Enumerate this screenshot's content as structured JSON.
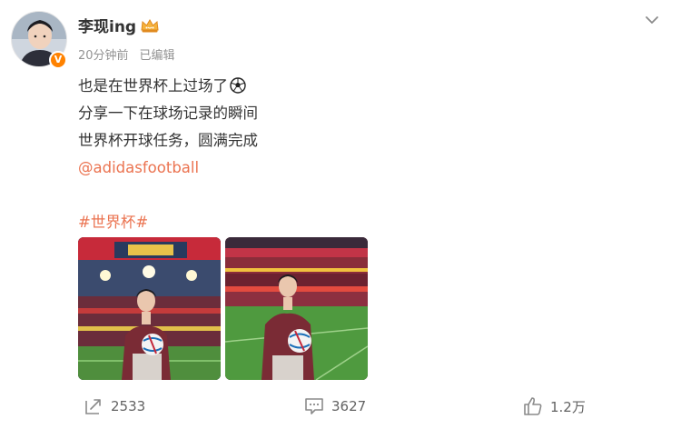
{
  "post": {
    "author": {
      "name": "李现ing",
      "verified_badge": "V",
      "vip_icon": "crown-icon"
    },
    "meta": {
      "time": "20分钟前",
      "edited": "已编辑"
    },
    "text": {
      "line1": "也是在世界杯上过场了",
      "line2": "分享一下在球场记录的瞬间",
      "line3": "世界杯开球任务，圆满完成",
      "mention": "@adidasfootball",
      "hashtag": "#世界杯#"
    },
    "images": [
      {
        "icon": "stadium-photo-1"
      },
      {
        "icon": "stadium-photo-2"
      }
    ],
    "actions": {
      "repost_count": "2533",
      "comment_count": "3627",
      "like_count": "1.2万"
    }
  },
  "colors": {
    "accent": "#eb7350",
    "verified": "#ff8200",
    "meta_text": "#939393",
    "action_text": "#636363"
  }
}
